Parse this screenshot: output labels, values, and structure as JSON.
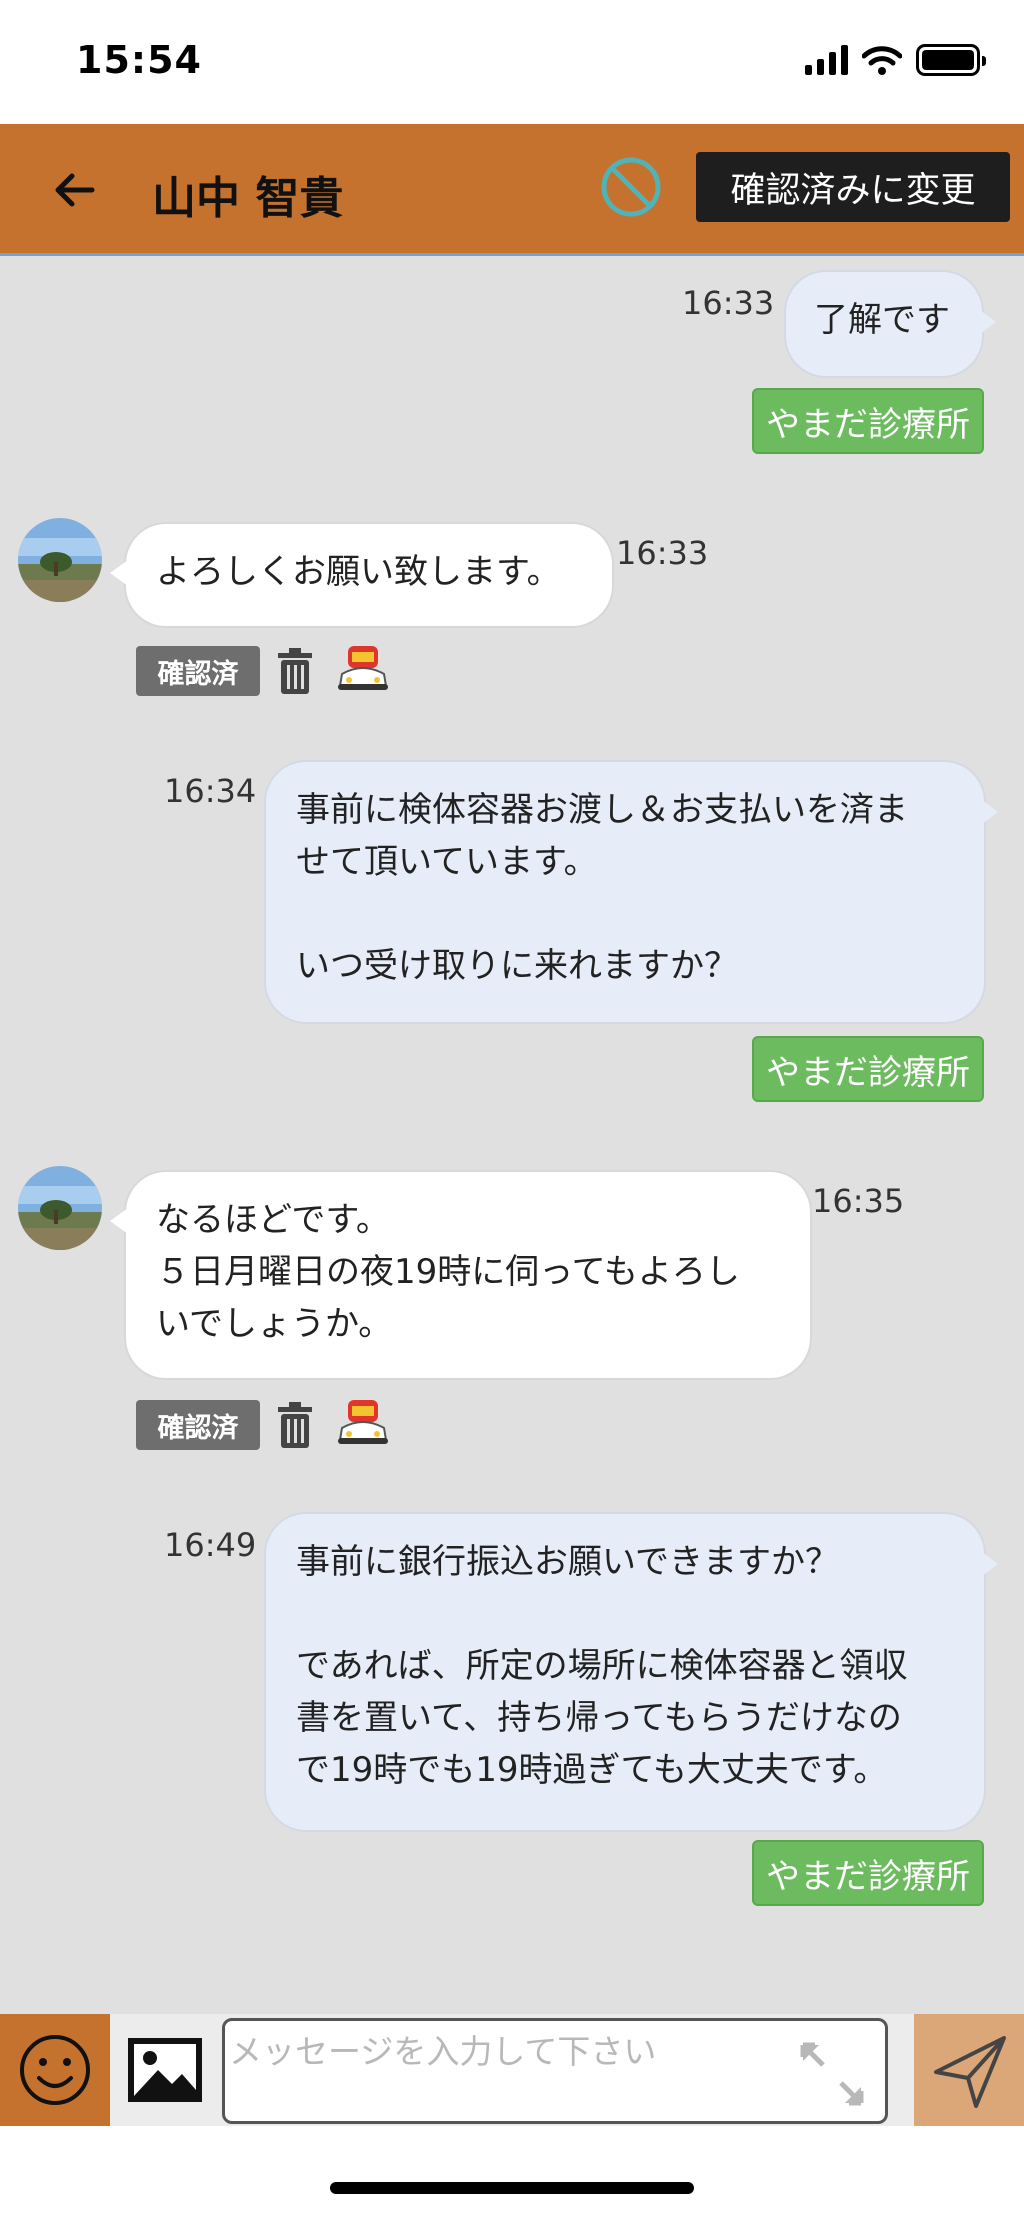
{
  "status_bar": {
    "time": "15:54"
  },
  "header": {
    "title": "山中 智貴",
    "confirm_button": "確認済みに変更"
  },
  "messages": [
    {
      "time": "16:33",
      "text": "了解です",
      "sender": "やまだ診療所"
    },
    {
      "time": "16:33",
      "text": "よろしくお願い致します。",
      "badge": "確認済"
    },
    {
      "time": "16:34",
      "line1": "事前に検体容器お渡し＆お支払いを済ま",
      "line2": "せて頂いています。",
      "line3": "いつ受け取りに来れますか？",
      "sender": "やまだ診療所"
    },
    {
      "time": "16:35",
      "line1": "なるほどです。",
      "line2": "５日月曜日の夜19時に伺ってもよろし",
      "line3": "いでしょうか。",
      "badge": "確認済"
    },
    {
      "time": "16:49",
      "line1": "事前に銀行振込お願いできますか？",
      "line2": "であれば、所定の場所に検体容器と領収",
      "line3": "書を置いて、持ち帰ってもらうだけなの",
      "line4": "で19時でも19時過ぎても大丈夫です。",
      "sender": "やまだ診療所"
    }
  ],
  "input": {
    "placeholder": "メッセージを入力して下さい"
  },
  "colors": {
    "header": "#c5722f",
    "sender_tag": "#6cbb5f",
    "my_bubble": "#e6ecf8",
    "send_button": "#dba779"
  }
}
